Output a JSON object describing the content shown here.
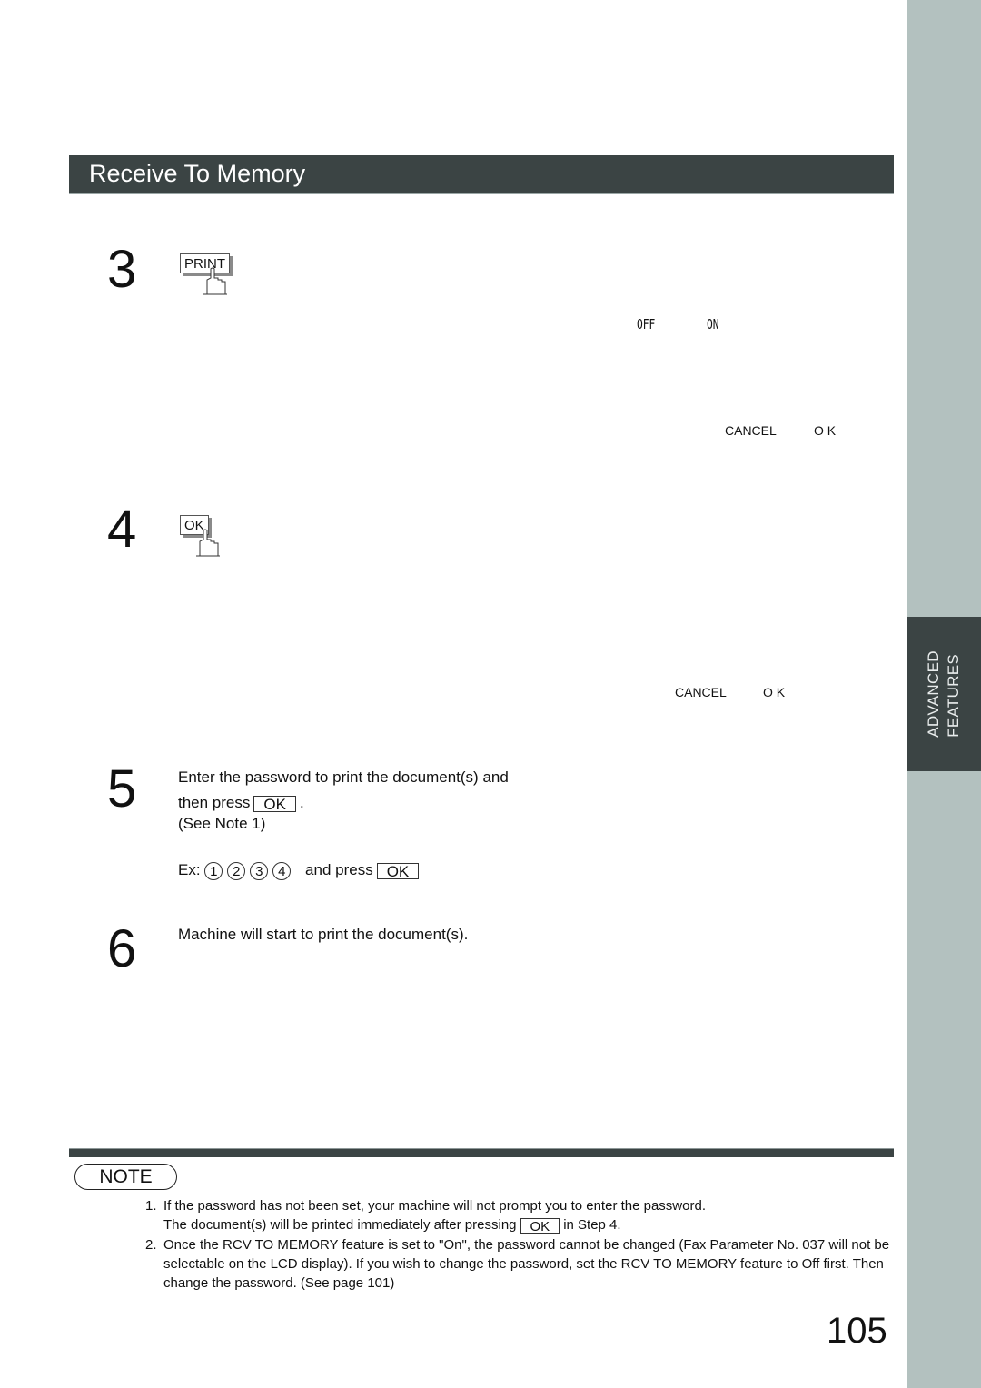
{
  "section": {
    "title": "Receive To Memory"
  },
  "side_tab": {
    "line1": "ADVANCED",
    "line2": "FEATURES"
  },
  "steps": {
    "s3": {
      "number": "3",
      "key_label": "PRINT",
      "lcd_options": {
        "left": "OFF",
        "right": "ON"
      },
      "soft_keys": {
        "left": "CANCEL",
        "right": "O K"
      }
    },
    "s4": {
      "number": "4",
      "key_label": "OK",
      "soft_keys": {
        "left": "CANCEL",
        "right": "O K"
      }
    },
    "s5": {
      "number": "5",
      "line1": "Enter the password to print the document(s) and",
      "line2_prefix": "then press",
      "key_label": "OK",
      "line2_suffix": ".",
      "line3": "(See Note 1)",
      "example_prefix": "Ex:",
      "example_digits": [
        "1",
        "2",
        "3",
        "4"
      ],
      "example_mid": "and press",
      "example_key": "OK"
    },
    "s6": {
      "number": "6",
      "text": "Machine will start to print the document(s)."
    }
  },
  "note": {
    "label": "NOTE",
    "items": [
      {
        "num": "1.",
        "line1": "If the password has not been set, your machine will not prompt you to enter the password.",
        "line2_prefix": "The document(s) will be printed immediately after pressing",
        "key_label": "OK",
        "line2_suffix": "in Step 4."
      },
      {
        "num": "2.",
        "text": "Once the RCV TO MEMORY feature is set to \"On\",  the password cannot be changed (Fax Parameter No. 037 will not be selectable on the LCD display).  If you wish to change the password, set the RCV TO MEMORY feature to  Off  first.  Then change the password.  (See page 101)"
      }
    ]
  },
  "page_number": "105"
}
